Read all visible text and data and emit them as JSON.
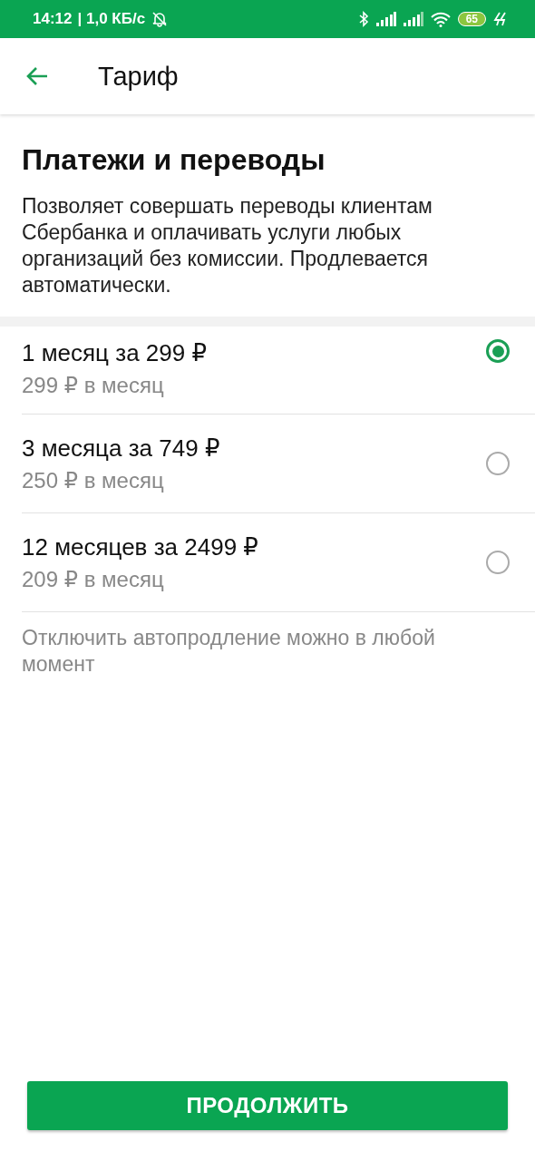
{
  "status_bar": {
    "time": "14:12",
    "speed": "| 1,0 КБ/с",
    "battery": "65"
  },
  "toolbar": {
    "title": "Тариф"
  },
  "heading": "Платежи и переводы",
  "description": "Позволяет совершать переводы клиентам Сбербанка и оплачивать услуги любых организаций без комиссии. Продлевается автоматически.",
  "options": [
    {
      "title": "1 месяц за 299 ₽",
      "subtitle": "299 ₽ в месяц",
      "selected": true
    },
    {
      "title": "3 месяца за 749 ₽",
      "subtitle": "250 ₽ в месяц",
      "selected": false
    },
    {
      "title": "12 месяцев за 2499 ₽",
      "subtitle": "209 ₽ в месяц",
      "selected": false
    }
  ],
  "note": "Отключить автопродление можно в любой момент",
  "button": "ПРОДОЛЖИТЬ"
}
